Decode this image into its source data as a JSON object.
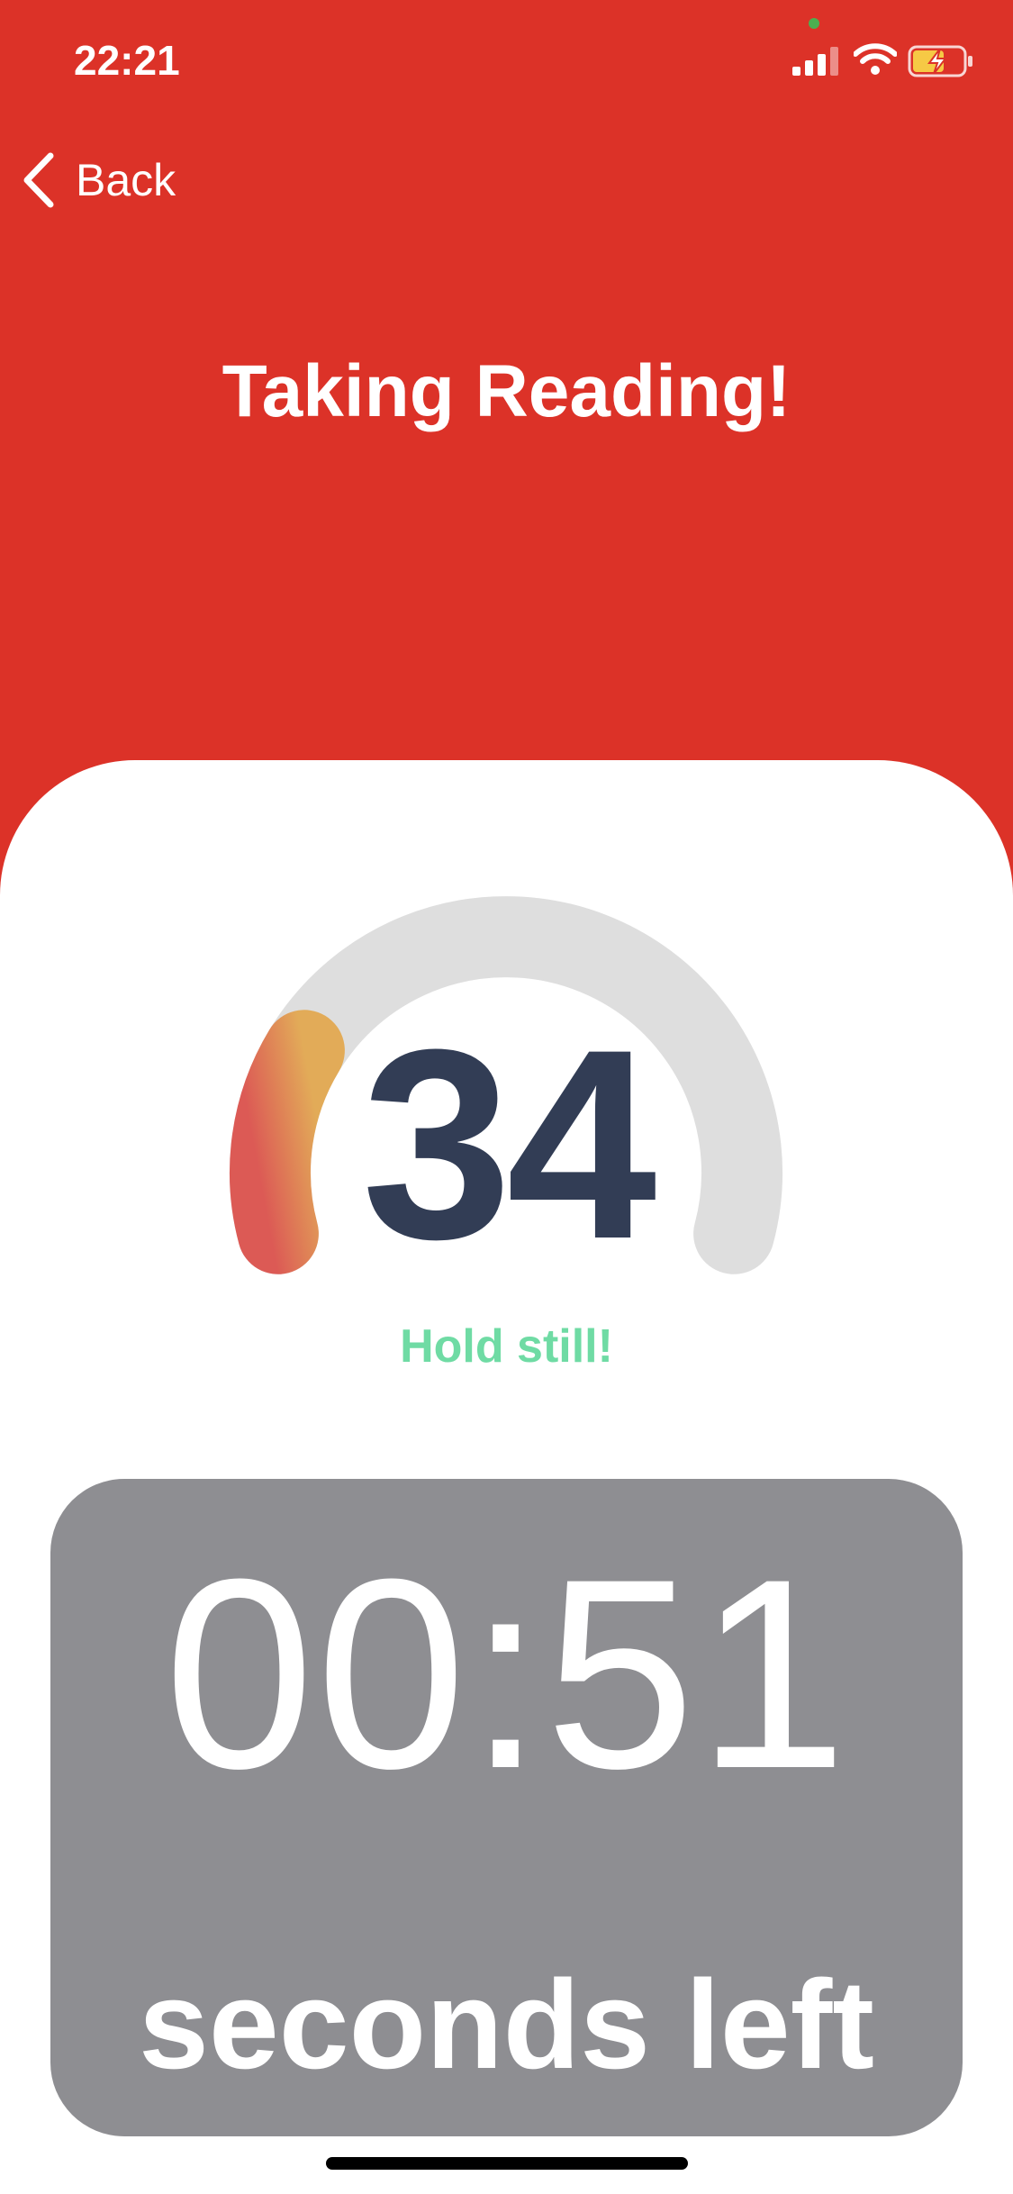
{
  "status_bar": {
    "time": "22:21",
    "icons": [
      "signal-icon",
      "wifi-icon",
      "battery-charging-icon"
    ]
  },
  "nav": {
    "back_label": "Back",
    "back_icon": "chevron-left-icon"
  },
  "header": {
    "title": "Taking Reading!"
  },
  "gauge": {
    "value": "34",
    "progress_fraction": 0.22,
    "message": "Hold still!",
    "colors": {
      "track": "#dedede",
      "fill_start": "#dc5a55",
      "fill_end": "#e2ab58",
      "value_text": "#323d55",
      "message_text": "#6fdba4"
    }
  },
  "timer": {
    "value": "00:51",
    "caption": "seconds left"
  },
  "colors": {
    "header_background": "#dc3228",
    "card_background": "#ffffff",
    "timer_panel": "#8e8e92"
  }
}
